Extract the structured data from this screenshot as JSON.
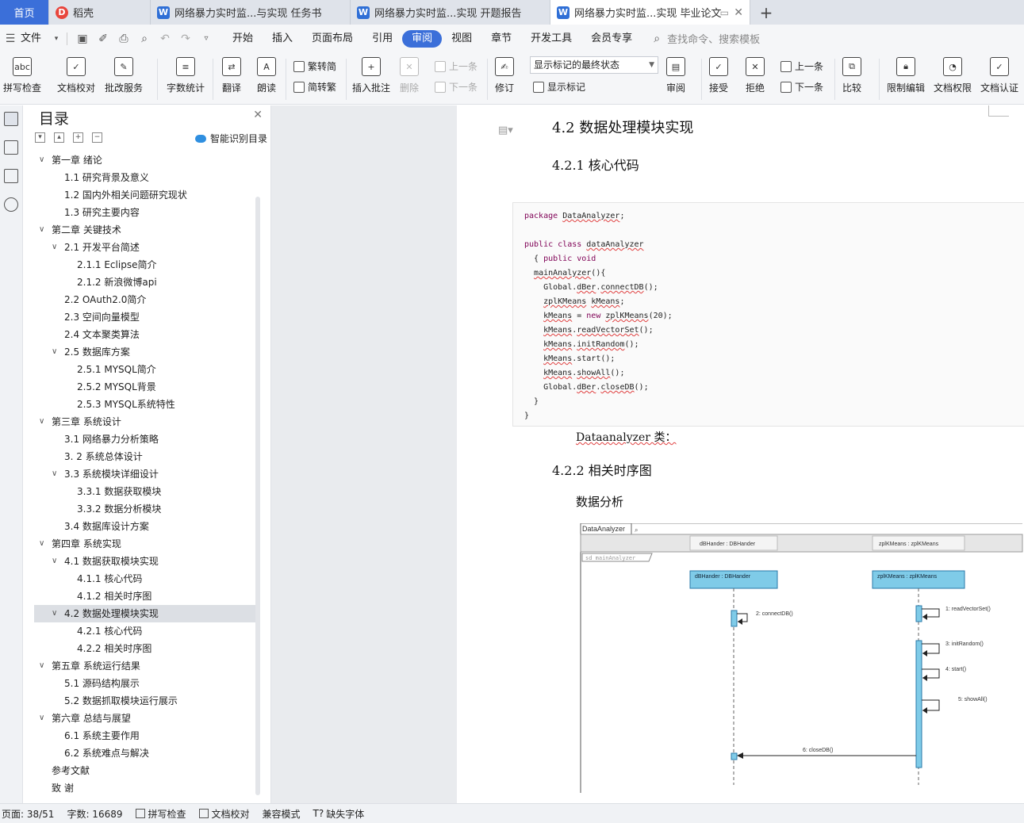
{
  "tabs": {
    "home": "首页",
    "daoke": "稻壳",
    "doc1": "网络暴力实时监...与实现 任务书",
    "doc2": "网络暴力实时监...实现 开题报告",
    "doc3": "网络暴力实时监...实现 毕业论文",
    "add": "+"
  },
  "menu": {
    "file": "文件",
    "items": [
      "开始",
      "插入",
      "页面布局",
      "引用",
      "审阅",
      "视图",
      "章节",
      "开发工具",
      "会员专享"
    ],
    "active": "审阅",
    "search_placeholder": "查找命令、搜索模板"
  },
  "ribbon": {
    "spellcheck": "拼写检查",
    "doccheck": "文档校对",
    "batchservice": "批改服务",
    "wordcount": "字数统计",
    "translate": "翻译",
    "read": "朗读",
    "trad2simp": "繁转简",
    "simp2trad": "简转繁",
    "insert_comment": "插入批注",
    "delete": "删除",
    "prev_comment": "上一条",
    "next_comment": "下一条",
    "revise": "修订",
    "markup_select": "显示标记的最终状态",
    "show_markup": "显示标记",
    "review": "审阅",
    "accept": "接受",
    "reject": "拒绝",
    "prev_change": "上一条",
    "next_change": "下一条",
    "compare": "比较",
    "restrict": "限制编辑",
    "permission": "文档权限",
    "certify": "文档认证"
  },
  "toc": {
    "title": "目录",
    "smart": "智能识别目录",
    "items": [
      {
        "label": "第一章 绪论",
        "level": 1,
        "expanded": true
      },
      {
        "label": "1.1 研究背景及意义",
        "level": 2
      },
      {
        "label": "1.2 国内外相关问题研究现状",
        "level": 2
      },
      {
        "label": "1.3 研究主要内容",
        "level": 2
      },
      {
        "label": "第二章 关键技术",
        "level": 1,
        "expanded": true
      },
      {
        "label": "2.1 开发平台简述",
        "level": 2,
        "expanded": true
      },
      {
        "label": "2.1.1 Eclipse简介",
        "level": 3
      },
      {
        "label": "2.1.2 新浪微博api",
        "level": 3
      },
      {
        "label": "2.2 OAuth2.0简介",
        "level": 2
      },
      {
        "label": "2.3 空间向量模型",
        "level": 2
      },
      {
        "label": "2.4 文本聚类算法",
        "level": 2
      },
      {
        "label": "2.5 数据库方案",
        "level": 2,
        "expanded": true
      },
      {
        "label": "2.5.1 MYSQL简介",
        "level": 3
      },
      {
        "label": "2.5.2 MYSQL背景",
        "level": 3
      },
      {
        "label": "2.5.3 MYSQL系统特性",
        "level": 3
      },
      {
        "label": "第三章 系统设计",
        "level": 1,
        "expanded": true
      },
      {
        "label": "3.1 网络暴力分析策略",
        "level": 2
      },
      {
        "label": "3. 2 系统总体设计",
        "level": 2
      },
      {
        "label": "3.3 系统模块详细设计",
        "level": 2,
        "expanded": true
      },
      {
        "label": "3.3.1 数据获取模块",
        "level": 3
      },
      {
        "label": "3.3.2 数据分析模块",
        "level": 3
      },
      {
        "label": "3.4 数据库设计方案",
        "level": 2
      },
      {
        "label": "第四章 系统实现",
        "level": 1,
        "expanded": true
      },
      {
        "label": "4.1 数据获取模块实现",
        "level": 2,
        "expanded": true
      },
      {
        "label": "4.1.1 核心代码",
        "level": 3
      },
      {
        "label": "4.1.2 相关时序图",
        "level": 3
      },
      {
        "label": "4.2 数据处理模块实现",
        "level": 2,
        "expanded": true,
        "selected": true
      },
      {
        "label": "4.2.1 核心代码",
        "level": 3
      },
      {
        "label": "4.2.2 相关时序图",
        "level": 3
      },
      {
        "label": "第五章 系统运行结果",
        "level": 1,
        "expanded": true
      },
      {
        "label": "5.1 源码结构展示",
        "level": 2
      },
      {
        "label": "5.2 数据抓取模块运行展示",
        "level": 2
      },
      {
        "label": "第六章 总结与展望",
        "level": 1,
        "expanded": true
      },
      {
        "label": "6.1 系统主要作用",
        "level": 2
      },
      {
        "label": "6.2 系统难点与解决",
        "level": 2
      },
      {
        "label": "参考文献",
        "level": 1
      },
      {
        "label": "致  谢",
        "level": 1
      }
    ]
  },
  "document": {
    "h_42": "4.2 数据处理模块实现",
    "h_421": "4.2.1 核心代码",
    "code_lines": [
      "package DataAnalyzer;",
      "",
      "public class dataAnalyzer",
      "  { public void",
      "  mainAnalyzer(){",
      "    Global.dBer.connectDB();",
      "    zplKMeans kMeans;",
      "    kMeans = new zplKMeans(20);",
      "    kMeans.readVectorSet();",
      "    kMeans.initRandom();",
      "    kMeans.start();",
      "    kMeans.showAll();",
      "    Global.dBer.closeDB();",
      "  }",
      "}"
    ],
    "caption": "Dataanalyzer 类：",
    "h_422": "4.2.2 相关时序图",
    "para": "数据分析",
    "diagram": {
      "frame_title": "DataAnalyzer",
      "header_left": "dBHander : DBHander",
      "header_right": "zplKMeans : zplKMeans",
      "sd_label": "sd  mainAnalyzer",
      "lifeline_left": "dBHander : DBHander",
      "lifeline_right": "zplKMeans : zplKMeans",
      "msg2": "2: connectDB()",
      "msg1": "1: readVectorSet()",
      "msg3": "3: initRandom()",
      "msg4": "4: start()",
      "msg5": "5: showAll()",
      "msg6": "6: closeDB()",
      "lifeline_color": "#7fcbe8"
    }
  },
  "status": {
    "page": "页面: 38/51",
    "words": "字数: 16689",
    "spell": "拼写检查",
    "doccheck": "文档校对",
    "compat": "兼容模式",
    "missing_font": "缺失字体"
  }
}
